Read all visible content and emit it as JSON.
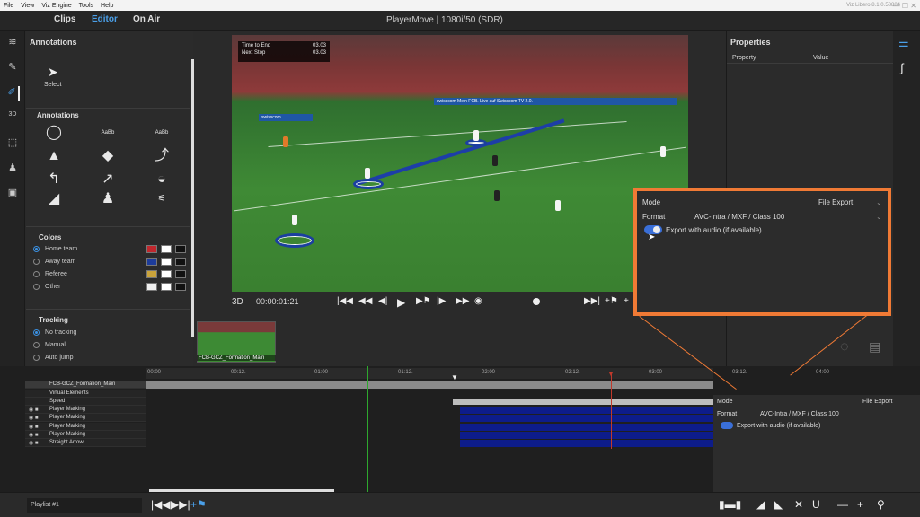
{
  "menu": [
    "File",
    "View",
    "Viz Engine",
    "Tools",
    "Help"
  ],
  "tabs": [
    "Clips",
    "Editor",
    "On Air"
  ],
  "window_title": "PlayerMove | 1080i/50 (SDR)",
  "version": "Viz Libero 8.1.0.58884",
  "annotations": {
    "title": "Annotations",
    "select_label": "Select",
    "section_title": "Annotations",
    "colors_title": "Colors",
    "colors": [
      {
        "label": "Home team",
        "selected": true
      },
      {
        "label": "Away team",
        "selected": false
      },
      {
        "label": "Referee",
        "selected": false
      },
      {
        "label": "Other",
        "selected": false
      }
    ],
    "tracking_title": "Tracking",
    "tracking": [
      {
        "label": "No tracking",
        "selected": true
      },
      {
        "label": "Manual",
        "selected": false
      },
      {
        "label": "Auto jump",
        "selected": false
      }
    ],
    "shape_text": "AaBb"
  },
  "viewer": {
    "info": [
      {
        "label": "Time to End",
        "value": "03.03"
      },
      {
        "label": "Next Stop",
        "value": "03.03"
      }
    ],
    "three_d": "3D",
    "timecode": "00:00:01:21",
    "ads": [
      "swisscom",
      "Mein FCB. Live auf Swisscom TV 2.0.",
      "swisscom Mein FCB. Live auf Swisscom TV 2.0."
    ]
  },
  "properties": {
    "title": "Properties",
    "col_property": "Property",
    "col_value": "Value"
  },
  "callout": {
    "mode_label": "Mode",
    "mode_value": "File Export",
    "format_label": "Format",
    "format_value": "AVC-Intra / MXF / Class 100",
    "audio_label": "Export with audio (if available)",
    "audio_on": true
  },
  "clip": {
    "thumb_label": "FCB-GCZ_Formation_Main"
  },
  "ruler_ticks": [
    "00:00",
    "00:12.",
    "01:00",
    "01:12.",
    "02:00",
    "02:12.",
    "03:00",
    "03:12.",
    "04:00"
  ],
  "tracks": [
    "FCB-GCZ_Formation_Main",
    "Virtual Elements",
    "Speed",
    "Player Marking",
    "Player Marking",
    "Player Marking",
    "Player Marking",
    "Straight Arrow"
  ],
  "playlist": "Playlist #1"
}
